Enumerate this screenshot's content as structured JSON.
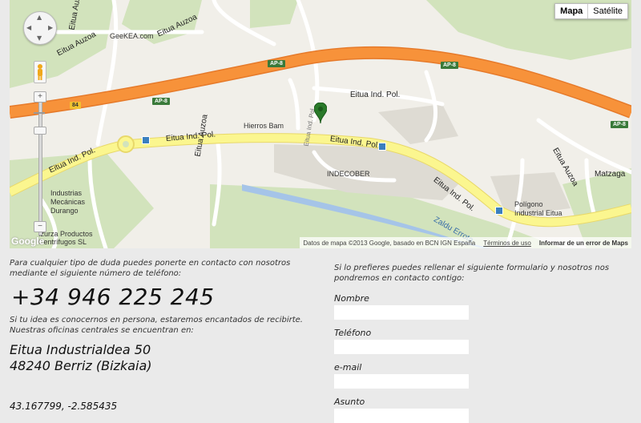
{
  "map": {
    "map_types": [
      "Mapa",
      "Satélite"
    ],
    "active_type": "Mapa",
    "zoom_in": "+",
    "zoom_out": "−",
    "logo": "Google",
    "attribution": "Datos de mapa ©2013 Google, basado en BCN IGN España",
    "terms": "Términos de uso",
    "report_error": "Informar de un error de Maps",
    "labels": {
      "geekea": "GeeKEA.com",
      "eitua_auzoa_1": "Eitua Auzoa",
      "eitua_auzoa_2": "Eitua Auzoa",
      "eitua_auzoa_3": "Eitua Auzoa",
      "eitua_auzoa_4": "Eitua Auzoa",
      "eitua_auzoa_5": "Eitua Auzoa",
      "eitua_ind_pol_1": "Eitua Ind. Pol.",
      "eitua_ind_pol_2": "Eitua Ind. Pol.",
      "eitua_ind_pol_3": "Eitua Ind. Pol.",
      "eitua_ind_pol_4": "Eitua Ind. Pol.",
      "eitua_ind_pol_5": "Eitua Ind. Pol.",
      "hierros": "Hierros Bam",
      "indecober": "INDECOBER",
      "industrias": [
        "Industrias",
        "Mecánicas",
        "Durango"
      ],
      "izurza": [
        "Izurza Productos",
        "Centrífugos SL"
      ],
      "poligono": [
        "Polígono",
        "Industrial Eitua"
      ],
      "zaldu": "Zaldu Errota",
      "matzaga": "Matzaga",
      "ap8": "AP-8",
      "n84": "84"
    }
  },
  "contact": {
    "intro": "Para cualquier tipo de duda puedes ponerte en contacto con nosotros mediante el siguiente número de teléfono:",
    "phone": "+34 946 225 245",
    "visit": "Si tu idea es conocernos en persona, estaremos encantados de recibirte. Nuestras oficinas centrales se encuentran en:",
    "address_line1": "Eitua Industrialdea 50",
    "address_line2": "48240 Berriz (Bizkaia)",
    "coordinates": "43.167799, -2.585435"
  },
  "form": {
    "intro": "Si lo prefieres puedes rellenar el siguiente formulario y nosotros nos pondremos en contacto contigo:",
    "fields": [
      {
        "label": "Nombre",
        "value": ""
      },
      {
        "label": "Teléfono",
        "value": ""
      },
      {
        "label": "e-mail",
        "value": ""
      },
      {
        "label": "Asunto",
        "value": ""
      }
    ]
  },
  "colors": {
    "motorway": "#f7923a",
    "road": "#fbf68f",
    "park": "#cfe2b8",
    "water": "#a5c4e8",
    "industrial": "#dedbd3",
    "pin": "#2a7a2a"
  }
}
